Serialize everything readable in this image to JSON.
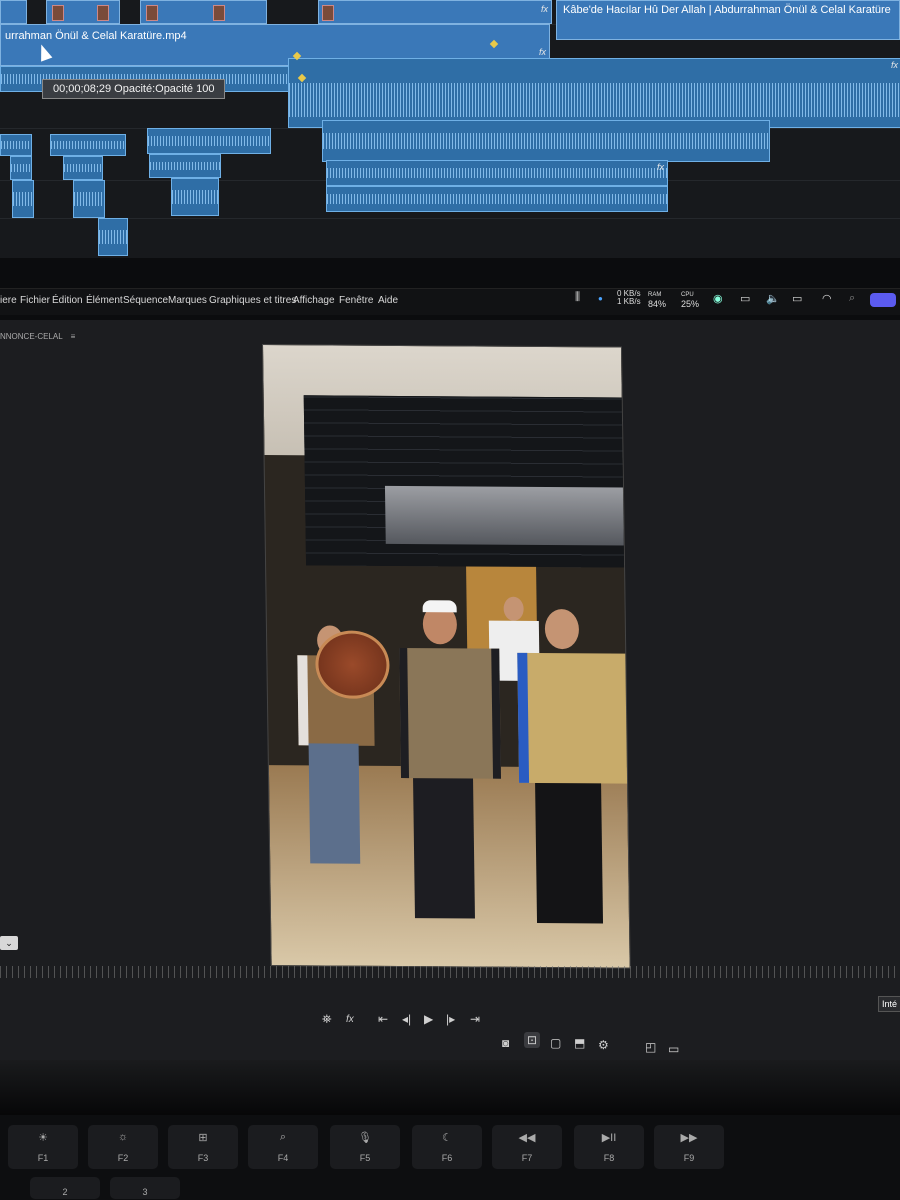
{
  "timeline": {
    "clip_name_left": "urrahman Önül & Celal Karatüre.mp4",
    "clip_name_right": "Kâbe'de Hacılar Hû Der Allah  |  Abdurrahman Önül & Celal Karatüre",
    "fx_label": "fx",
    "tooltip": "00;00;08;29  Opacité:Opacité  100"
  },
  "menu": {
    "items": [
      "iere",
      "Fichier",
      "Édition",
      "Élément",
      "Séquence",
      "Marques",
      "Graphiques et titres",
      "Affichage",
      "Fenêtre",
      "Aide"
    ]
  },
  "status": {
    "net_up": "0 KB/s",
    "net_down": "1 KB/s",
    "ram_label": "RAM",
    "ram_value": "84%",
    "cpu_label": "CPU",
    "cpu_value": "25%"
  },
  "panel": {
    "title": "NNONCE-CELAL",
    "menu_glyph": "≡"
  },
  "controls": {
    "int_button": "Inté",
    "fx": "fx"
  },
  "keyboard": {
    "keys": [
      {
        "label": "F1",
        "icon": "☀"
      },
      {
        "label": "F2",
        "icon": "☼"
      },
      {
        "label": "F3",
        "icon": "⊞"
      },
      {
        "label": "F4",
        "icon": "⌕"
      },
      {
        "label": "F5",
        "icon": "🎙"
      },
      {
        "label": "F6",
        "icon": "☾"
      },
      {
        "label": "F7",
        "icon": "◀◀"
      },
      {
        "label": "F8",
        "icon": "▶II"
      },
      {
        "label": "F9",
        "icon": "▶▶"
      }
    ],
    "numbers": [
      "2",
      "3"
    ]
  }
}
